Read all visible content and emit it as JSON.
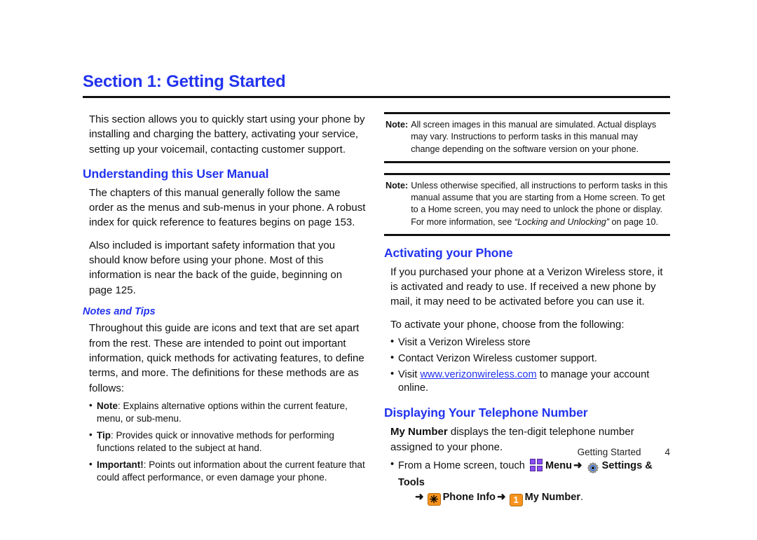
{
  "document": {
    "section_title": "Section 1: Getting Started",
    "heading_color": "#2233ee",
    "link_color": "#2233ee"
  },
  "left_column": {
    "intro_paragraph": "This section allows you to quickly start using your phone by installing and charging the battery, activating your service, setting up your voicemail, contacting customer support.",
    "heading_understanding": "Understanding this User Manual",
    "para_chapters": "The chapters of this manual generally follow the same order as the menus and sub-menus in your phone. A robust index for quick reference to features begins on page 153.",
    "para_safety": "Also included is important safety information that you should know before using your phone. Most of this information is near the back of the guide, beginning on page 125.",
    "subheading_notes_tips": "Notes and Tips",
    "para_throughout": "Throughout this guide are icons and text that are set apart from the rest. These are intended to point out important information, quick methods for activating features, to define terms, and more. The definitions for these methods are as follows:",
    "definitions": [
      {
        "term": "Note",
        "text": ": Explains alternative options within the current feature, menu, or sub-menu."
      },
      {
        "term": "Tip",
        "text": ": Provides quick or innovative methods for performing functions related to the subject at hand."
      },
      {
        "term": "Important!",
        "text": ": Points out information about the current feature that could affect performance, or even damage your phone."
      }
    ]
  },
  "right_column": {
    "note_1": {
      "label": "Note:",
      "text": "All screen images in this manual are simulated. Actual displays may vary. Instructions to perform tasks in this manual may change depending on the software version on your phone."
    },
    "note_2": {
      "label": "Note:",
      "text_part1": "Unless otherwise specified, all instructions to perform tasks in this manual assume that you are starting from a Home screen. To get to a Home screen, you may need to unlock the phone or display. For more information, see ",
      "text_italic": "“Locking and Unlocking”",
      "text_part2": " on page 10."
    },
    "heading_activating": "Activating your Phone",
    "para_purchased": "If you purchased your phone at a Verizon Wireless store, it is activated and ready to use. If received a new phone by mail, it may need to be activated before you can use it.",
    "para_to_activate": "To activate your phone, choose from the following:",
    "activation_bullets": [
      "Visit a Verizon Wireless store",
      "Contact Verizon Wireless customer support."
    ],
    "visit_bullet": {
      "prefix": "Visit ",
      "link": "www.verizonwireless.com",
      "suffix": " to manage your account online."
    },
    "heading_displaying": "Displaying Your Telephone Number",
    "my_number": {
      "bold_lead": "My Number",
      "rest": " displays the ten-digit telephone number assigned to your  phone."
    },
    "step": {
      "intro": "From a Home screen, touch ",
      "menu_label": "Menu",
      "arrow": "➜",
      "settings_label": "Settings & Tools",
      "phone_info_label": "Phone Info",
      "star_key": "✳",
      "one_key": "1",
      "my_number_label": "My Number",
      "period": "."
    }
  },
  "footer": {
    "label": "Getting Started",
    "page_number": "4"
  }
}
